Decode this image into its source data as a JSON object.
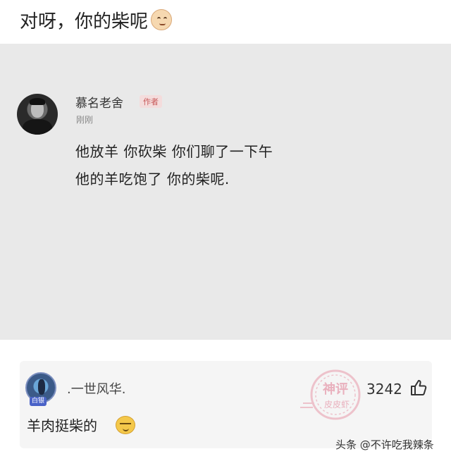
{
  "post": {
    "title": "对呀，你的柴呢"
  },
  "screenshot": {
    "author_name": "慕名老舍",
    "author_badge": "作者",
    "time": "刚刚",
    "lines": [
      "他放羊 你砍柴 你们聊了一下午",
      "他的羊吃饱了 你的柴呢."
    ]
  },
  "comment": {
    "username": ".一世风华.",
    "avatar_badge": "白银",
    "text": "羊肉挺柴的",
    "likes": "3242",
    "stamp_text_top": "神评",
    "stamp_text_bottom": "皮皮虾"
  },
  "watermark": "头条 @不许吃我辣条",
  "icons": {
    "title_emoji": "smirk-face-icon",
    "comment_emoji": "smug-face-icon",
    "like": "thumbs-up-icon"
  }
}
